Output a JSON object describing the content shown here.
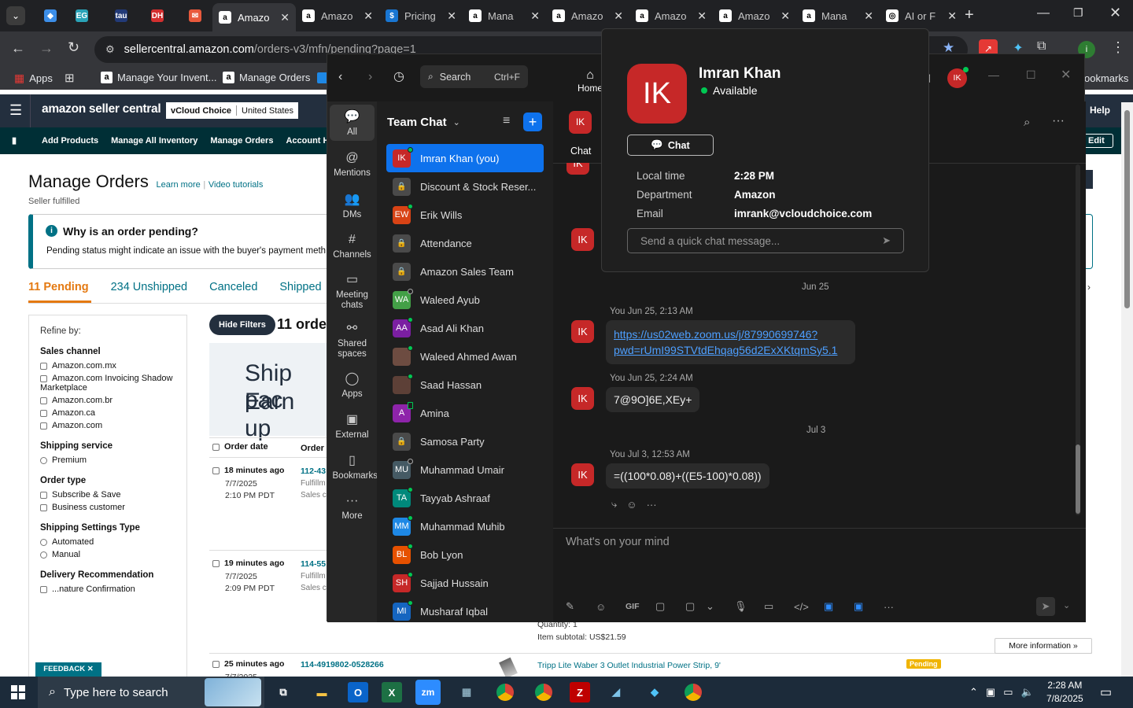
{
  "browser": {
    "tabs": [
      {
        "label": "",
        "fav": "#3c8ee8",
        "glyph": "◆"
      },
      {
        "label": "",
        "fav": "#2aa3b8",
        "glyph": "EG"
      },
      {
        "label": "",
        "fav": "#223a78",
        "glyph": "tau"
      },
      {
        "label": "",
        "fav": "#d32f2f",
        "glyph": "DH"
      },
      {
        "label": "",
        "fav": "#e8593c",
        "glyph": "✉"
      },
      {
        "label": "Amazo",
        "fav": "#fff",
        "glyph": "a",
        "active": true
      },
      {
        "label": "Amazo",
        "fav": "#fff",
        "glyph": "a"
      },
      {
        "label": "Pricing",
        "fav": "#1976d2",
        "glyph": "$"
      },
      {
        "label": "Mana",
        "fav": "#fff",
        "glyph": "a"
      },
      {
        "label": "Amazo",
        "fav": "#fff",
        "glyph": "a"
      },
      {
        "label": "Amazo",
        "fav": "#fff",
        "glyph": "a"
      },
      {
        "label": "Amazo",
        "fav": "#fff",
        "glyph": "a"
      },
      {
        "label": "Mana",
        "fav": "#fff",
        "glyph": "a"
      },
      {
        "label": "AI or F",
        "fav": "#fff",
        "glyph": "◎"
      }
    ],
    "url": "sellercentral.amazon.com/orders-v3/mfn/pending?page=1",
    "url_domain": "sellercentral.amazon.com",
    "url_path": "/orders-v3/mfn/pending?page=1",
    "bookmarks": [
      "Apps",
      "Manage Your Invent...",
      "Manage Orders"
    ],
    "bookmarks_right": "ookmarks"
  },
  "amazon": {
    "logo": "amazon seller central",
    "account": "vCloud Choice",
    "marketplace": "United States",
    "help": "Help",
    "edit": "Edit",
    "nav": [
      "Add Products",
      "Manage All Inventory",
      "Manage Orders",
      "Account Health"
    ],
    "page_title": "Manage Orders",
    "learn_more": "Learn more",
    "video_tutorials": "Video tutorials",
    "subtitle": "Seller fulfilled",
    "info_title": "Why is an order pending?",
    "info_text": "Pending status might indicate an issue with the buyer's payment meth",
    "tabs": [
      "11 Pending",
      "234 Unshipped",
      "Canceled",
      "Shipped"
    ],
    "refine": "Refine by:",
    "filters": [
      {
        "heading": "Sales channel",
        "type": "check",
        "items": [
          "Amazon.com.mx",
          "Amazon.com Invoicing Shadow Marketplace",
          "Amazon.com.br",
          "Amazon.ca",
          "Amazon.com"
        ]
      },
      {
        "heading": "Shipping service",
        "type": "radio",
        "items": [
          "Premium"
        ]
      },
      {
        "heading": "Order type",
        "type": "check",
        "items": [
          "Subscribe & Save",
          "Business customer"
        ]
      },
      {
        "heading": "Shipping Settings Type",
        "type": "radio",
        "items": [
          "Automated",
          "Manual"
        ]
      },
      {
        "heading": "Delivery Recommendation",
        "type": "check",
        "items": [
          "...nature Confirmation"
        ]
      }
    ],
    "hide_filters": "Hide Filters",
    "orders_count": "11 orde",
    "banner_line1": "Ship pac",
    "banner_line2": "Earn up",
    "col_order_date": "Order date",
    "col_order_details": "Order d",
    "orders": [
      {
        "age": "18 minutes ago",
        "date": "7/7/2025",
        "time": "2:10 PM PDT",
        "id": "112-43",
        "l1": "Fulfillm",
        "l2": "Sales ch"
      },
      {
        "age": "19 minutes ago",
        "date": "7/7/2025",
        "time": "2:09 PM PDT",
        "id": "114-55",
        "l1": "Fulfillm",
        "l2": "Sales ch"
      },
      {
        "age": "25 minutes ago",
        "date": "7/7/2025",
        "time": "",
        "id": "114-4919802-0528266",
        "l1": "",
        "l2": ""
      }
    ],
    "quantity": "Quantity: 1",
    "item_subtotal": "Item subtotal: US$21.59",
    "more_info": "More information »",
    "product": "Tripp Lite Waber 3 Outlet Industrial Power Strip, 9'",
    "pending_badge": "Pending",
    "feedback": "FEEDBACK ✕"
  },
  "zoom": {
    "search": "Search",
    "shortcut": "Ctrl+F",
    "home": "Home",
    "rail": [
      {
        "label": "All",
        "icon": "💬"
      },
      {
        "label": "Mentions",
        "icon": "@"
      },
      {
        "label": "DMs",
        "icon": "👥"
      },
      {
        "label": "Channels",
        "icon": "#"
      },
      {
        "label": "Meeting chats",
        "icon": "▭"
      },
      {
        "label": "Shared spaces",
        "icon": "⚯"
      },
      {
        "label": "Apps",
        "icon": "◯"
      },
      {
        "label": "External",
        "icon": "▣"
      },
      {
        "label": "Bookmarks",
        "icon": "▯"
      },
      {
        "label": "More",
        "icon": "···"
      }
    ],
    "team_chat": "Team Chat",
    "chats": [
      {
        "name": "Imran Khan (you)",
        "init": "IK",
        "color": "#c62828",
        "status": "on",
        "selected": true
      },
      {
        "name": "Discount & Stock Reser...",
        "init": "🔒",
        "color": "lock",
        "status": ""
      },
      {
        "name": "Erik Wills",
        "init": "EW",
        "color": "#d84315",
        "status": "on"
      },
      {
        "name": "Attendance",
        "init": "🔒",
        "color": "lock",
        "status": ""
      },
      {
        "name": "Amazon Sales Team",
        "init": "🔒",
        "color": "lock",
        "status": ""
      },
      {
        "name": "Waleed Ayub",
        "init": "WA",
        "color": "#43a047",
        "status": "off"
      },
      {
        "name": "Asad Ali Khan",
        "init": "AA",
        "color": "#7b1fa2",
        "status": "on"
      },
      {
        "name": "Waleed Ahmed Awan",
        "init": "",
        "color": "#6d4c41",
        "status": "on"
      },
      {
        "name": "Saad Hassan",
        "init": "",
        "color": "#5d4037",
        "status": "on"
      },
      {
        "name": "Amina",
        "init": "A",
        "color": "#8e24aa",
        "status": "phone"
      },
      {
        "name": "Samosa Party",
        "init": "🔒",
        "color": "lock",
        "status": ""
      },
      {
        "name": "Muhammad Umair",
        "init": "MU",
        "color": "#455a64",
        "status": "off"
      },
      {
        "name": "Tayyab Ashraaf",
        "init": "TA",
        "color": "#00897b",
        "status": "on"
      },
      {
        "name": "Muhammad Muhib",
        "init": "MM",
        "color": "#1e88e5",
        "status": "on"
      },
      {
        "name": "Bob Lyon",
        "init": "BL",
        "color": "#e65100",
        "status": "on"
      },
      {
        "name": "Sajjad Hussain",
        "init": "SH",
        "color": "#c62828",
        "status": "on"
      },
      {
        "name": "Musharaf Iqbal",
        "init": "MI",
        "color": "#1565c0",
        "status": "on"
      }
    ],
    "chat_tab": "Chat",
    "header_avatar": "IK",
    "date_jun25": "Jun 25",
    "date_jul3": "Jul 3",
    "messages": [
      {
        "meta": "You Jun 25, 2:13 AM",
        "text": "https://us02web.zoom.us/j/87990699746?pwd=rUmI99STVtdEhqag56d2ExXKtqmSy5.1",
        "line1": "https://us02web.zoom.us/j/87990699746?",
        "line2": "pwd=rUmI99STVtdEhqag56d2ExXKtqmSy5.1",
        "link": true
      },
      {
        "meta": "You Jun 25, 2:24 AM",
        "text": "7@9O]6E,XEy+"
      },
      {
        "meta": "You Jul 3, 12:53 AM",
        "text": "=((100*0.08)+((E5-100)*0.08))"
      }
    ],
    "composer_placeholder": "What's on your mind",
    "toolbar": [
      "✎",
      "☺",
      "GIF",
      "▢",
      "▢",
      "⌄",
      "🎙",
      "▭",
      "</>",
      "▣",
      "▣",
      "···"
    ]
  },
  "profile": {
    "initials": "IK",
    "name": "Imran Khan",
    "status": "Available",
    "chat_button": "Chat",
    "fields": [
      {
        "label": "Local time",
        "value": "2:28 PM"
      },
      {
        "label": "Department",
        "value": "Amazon"
      },
      {
        "label": "Email",
        "value": "imrank@vcloudchoice.com"
      }
    ],
    "quick_placeholder": "Send a quick chat message..."
  },
  "taskbar": {
    "search": "Type here to search",
    "time": "2:28 AM",
    "date": "7/8/2025"
  },
  "colors": {
    "zoom_blue": "#0e72ed",
    "amazon_orange": "#e47911",
    "avatar_red": "#c62828"
  }
}
